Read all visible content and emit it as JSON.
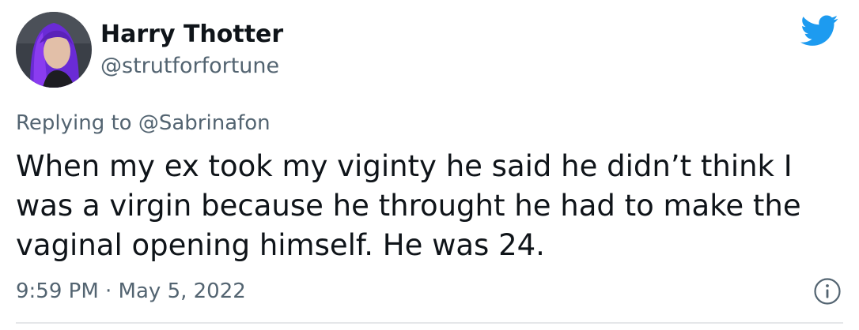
{
  "author": {
    "display_name": "Harry Thotter",
    "handle": "@strutforfortune",
    "avatar_icon": "user-avatar-photo"
  },
  "reply": {
    "prefix": "Replying to ",
    "to": "@Sabrinafon"
  },
  "tweet": {
    "text": "When my ex took my viginty he said he didn’t think I was a virgin because he throught he had to make the vaginal opening himself. He was 24.",
    "timestamp": "9:59 PM · May 5, 2022"
  },
  "icons": {
    "brand": "twitter-bird-icon",
    "info": "info-icon"
  },
  "colors": {
    "twitter_blue": "#1d9bf0",
    "text_primary": "#0f1419",
    "text_secondary": "#536471",
    "divider": "#e5e7e9"
  }
}
